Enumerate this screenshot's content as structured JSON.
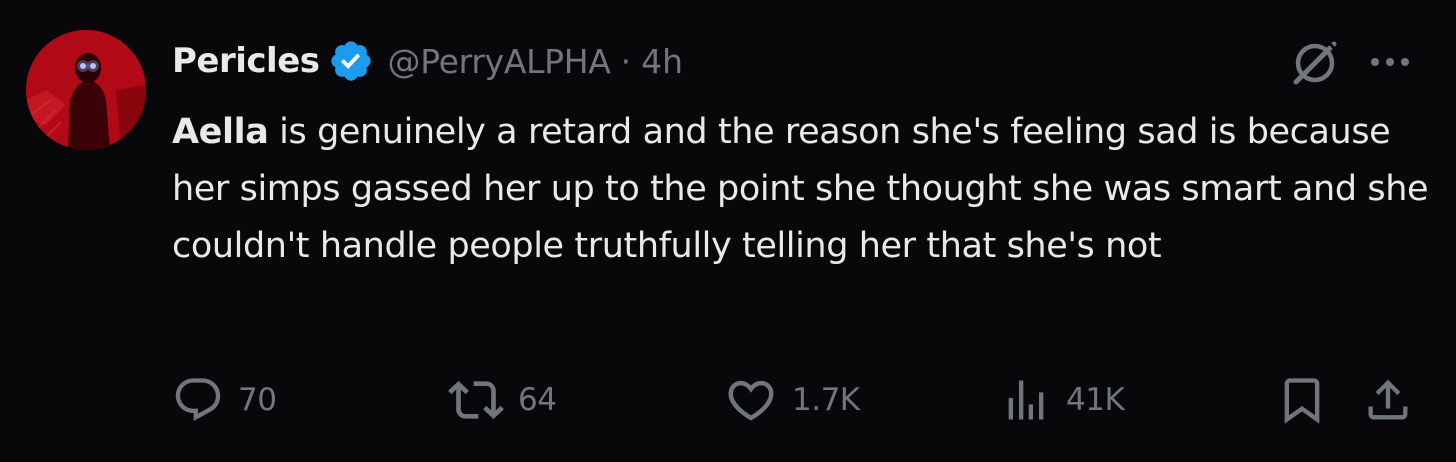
{
  "tweet": {
    "author": {
      "display_name": "Pericles",
      "handle": "@PerryALPHA",
      "verified": true,
      "avatar_icon": "avatar-photo"
    },
    "separator": "·",
    "time": "4h",
    "text": {
      "mention": "Aella",
      "rest": " is genuinely a retard and the reason she's feeling sad is because her simps gassed her up to the point she thought she was smart and she couldn't handle people truthfully telling her that she's not"
    },
    "actions": {
      "reply_count": "70",
      "retweet_count": "64",
      "like_count": "1.7K",
      "view_count": "41K"
    }
  },
  "colors": {
    "background": "#08080a",
    "text_primary": "#e7e9ea",
    "text_secondary": "#71767b",
    "verified_blue": "#1d9bf0"
  },
  "icons": {
    "grok": "grok-icon",
    "more": "more-icon",
    "reply": "reply-icon",
    "retweet": "retweet-icon",
    "like": "heart-icon",
    "views": "views-icon",
    "bookmark": "bookmark-icon",
    "share": "share-icon"
  }
}
